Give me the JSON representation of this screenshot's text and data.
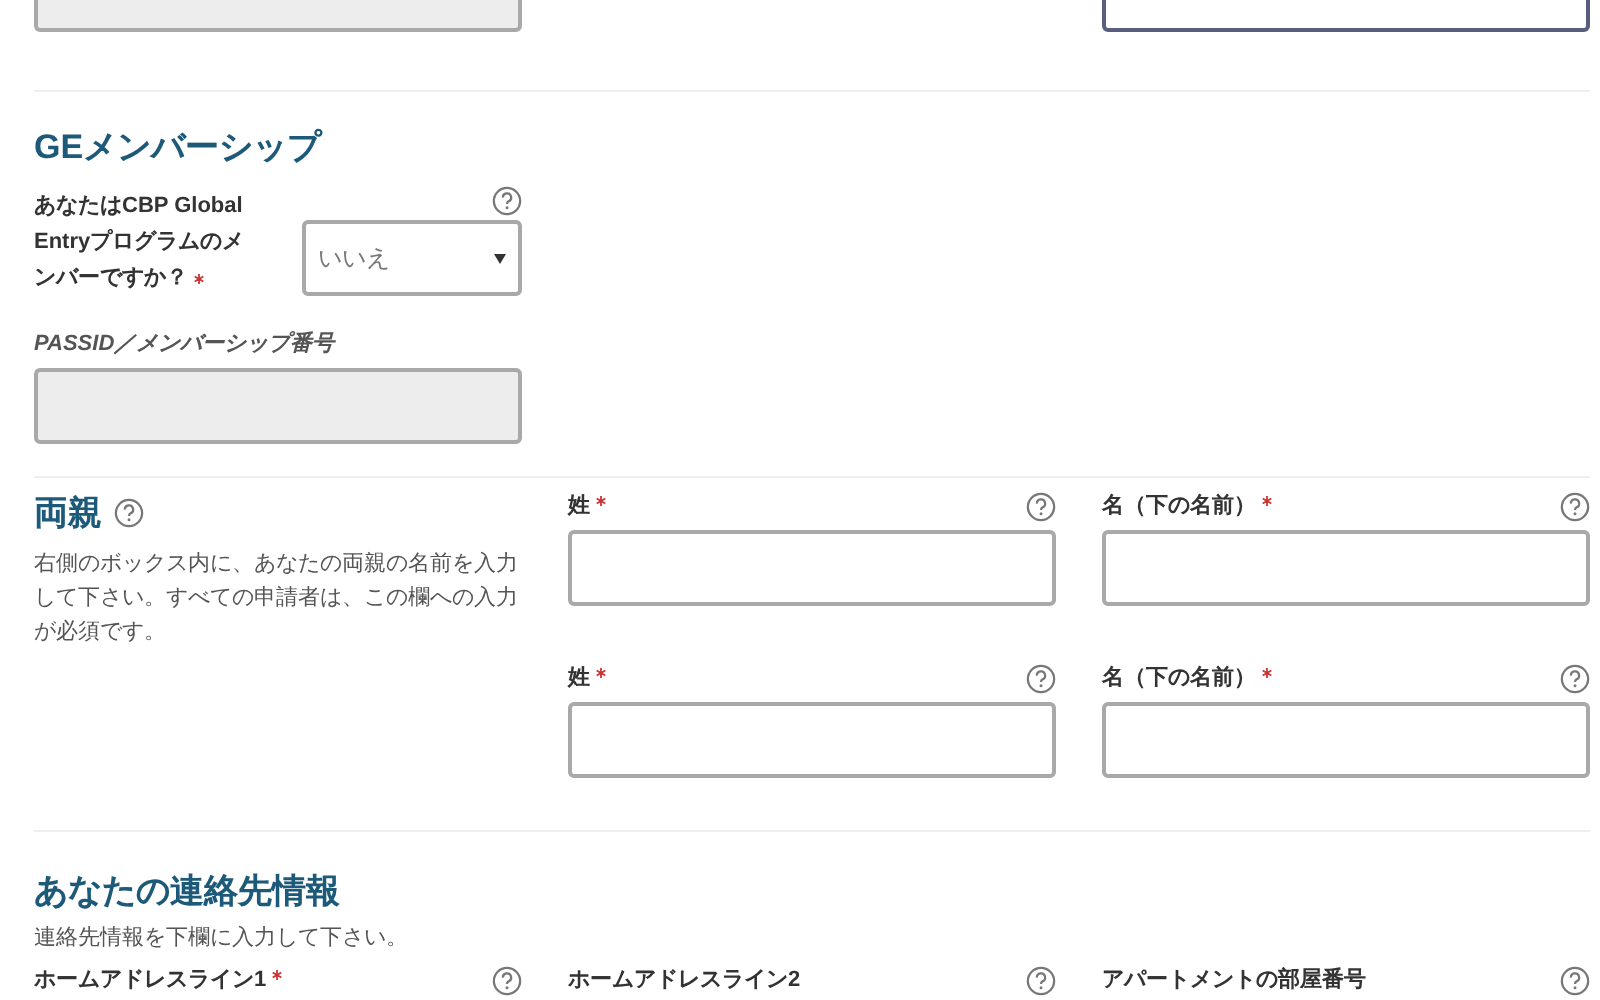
{
  "top_fields": [
    {
      "disabled": true,
      "focused": false
    },
    {
      "disabled": false,
      "focused": true
    }
  ],
  "ge_section": {
    "title": "GEメンバーシップ",
    "question": {
      "label": "あなたはCBP Global Entryプログラムのメンバーですか？",
      "required": true,
      "help": true,
      "value": "いいえ"
    },
    "passid": {
      "label": "PASSID／メンバーシップ番号",
      "required": false,
      "help": false,
      "disabled": true
    }
  },
  "parents": {
    "title": "両親",
    "help": true,
    "description": "右側のボックス内に、あなたの両親の名前を入力して下さい。すべての申請者は、この欄への入力が必須です。",
    "rows": [
      {
        "fields": [
          {
            "label": "姓",
            "required": true,
            "help": true
          },
          {
            "label": "名（下の名前）",
            "required": true,
            "help": true
          }
        ]
      },
      {
        "fields": [
          {
            "label": "姓",
            "required": true,
            "help": true
          },
          {
            "label": "名（下の名前）",
            "required": true,
            "help": true
          }
        ]
      }
    ]
  },
  "contact": {
    "title": "あなたの連絡先情報",
    "description": "連絡先情報を下欄に入力して下さい。",
    "fields": [
      {
        "label": "ホームアドレスライン1",
        "required": true,
        "help": true
      },
      {
        "label": "ホームアドレスライン2",
        "required": false,
        "help": true
      },
      {
        "label": "アパートメントの部屋番号",
        "required": false,
        "help": true
      }
    ]
  }
}
